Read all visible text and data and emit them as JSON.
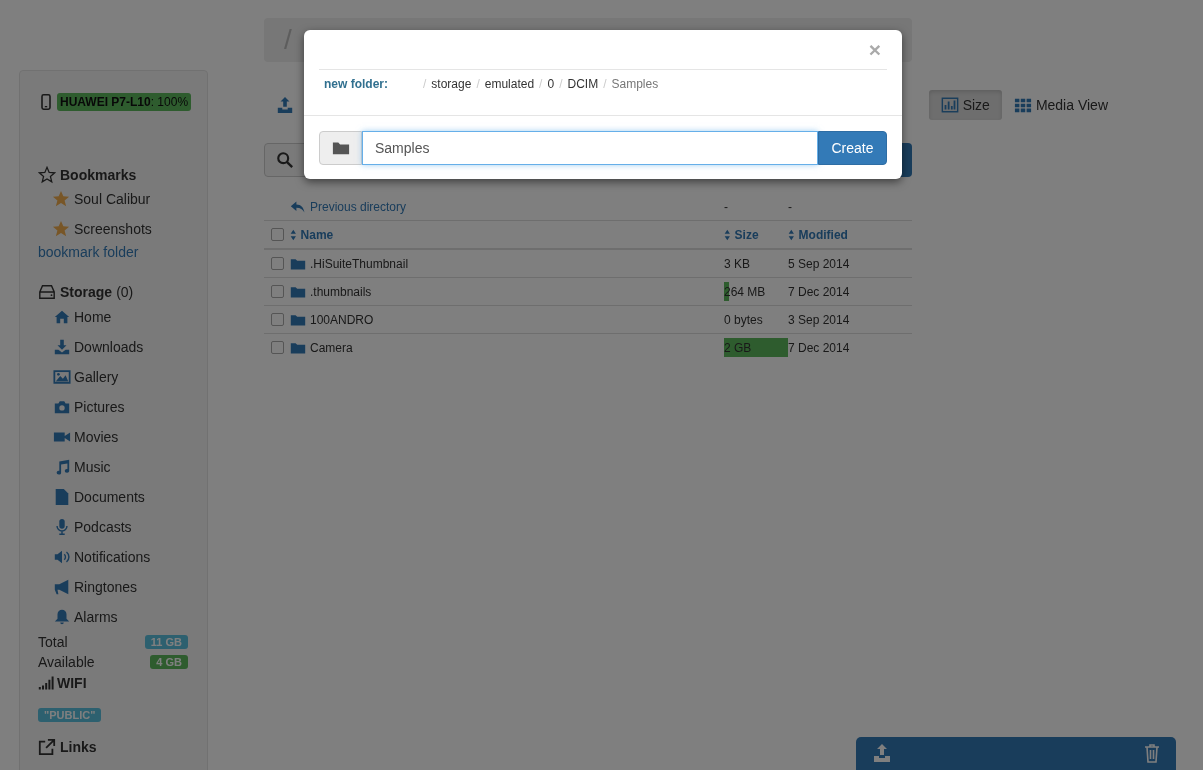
{
  "breadcrumb": {
    "root": "/"
  },
  "device": {
    "label": "**HUAWEI P7-L10**: 100%"
  },
  "bookmarks": {
    "title": "Bookmarks",
    "items": [
      "Soul Calibur",
      "Screenshots"
    ],
    "add_link": "bookmark folder"
  },
  "storage": {
    "title": "Storage",
    "count": "(0)",
    "items": [
      "Home",
      "Downloads",
      "Gallery",
      "Pictures",
      "Movies",
      "Music",
      "Documents",
      "Podcasts",
      "Notifications",
      "Ringtones",
      "Alarms"
    ],
    "total_label": "Total",
    "total": "11 GB",
    "available_label": "Available",
    "available": "4 GB"
  },
  "network": {
    "label": "WIFI",
    "ssid": "\"PUBLIC\""
  },
  "links": {
    "title": "Links"
  },
  "toolbar": [
    {
      "kind": "upload"
    },
    {
      "label": "Size",
      "kind": "size",
      "active": true
    },
    {
      "label": "Media View",
      "kind": "grid",
      "active": false
    }
  ],
  "table": {
    "previous": {
      "label": "Previous directory",
      "size": "-",
      "modified": "-"
    },
    "columns": [
      "Name",
      "Size",
      "Modified"
    ],
    "all_checked": false,
    "rows": [
      {
        "name": ".HiSuiteThumbnail",
        "size": "3 KB",
        "level": 0,
        "modified": "5 Sep 2014",
        "checked": false
      },
      {
        "name": ".thumbnails",
        "size": "264 MB",
        "level": 0.08,
        "modified": "7 Dec 2014",
        "checked": false
      },
      {
        "name": "100ANDRO",
        "size": "0 bytes",
        "level": 0,
        "modified": "3 Sep 2014",
        "checked": false
      },
      {
        "name": "Camera",
        "size": "2 GB",
        "level": 1,
        "modified": "7 Dec 2014",
        "checked": false
      }
    ]
  },
  "modal": {
    "close": "×",
    "label": "new folder:",
    "path": [
      {
        "kind": "sep",
        "label": "/"
      },
      {
        "kind": "dir",
        "label": "storage"
      },
      {
        "kind": "sep",
        "label": "/"
      },
      {
        "kind": "dir",
        "label": "emulated"
      },
      {
        "kind": "sep",
        "label": "/"
      },
      {
        "kind": "dir",
        "label": "0"
      },
      {
        "kind": "sep",
        "label": "/"
      },
      {
        "kind": "dir",
        "label": "DCIM"
      },
      {
        "kind": "sep",
        "label": "/"
      },
      {
        "kind": "current",
        "label": "Samples"
      }
    ],
    "value": "Samples",
    "button": "Create"
  }
}
